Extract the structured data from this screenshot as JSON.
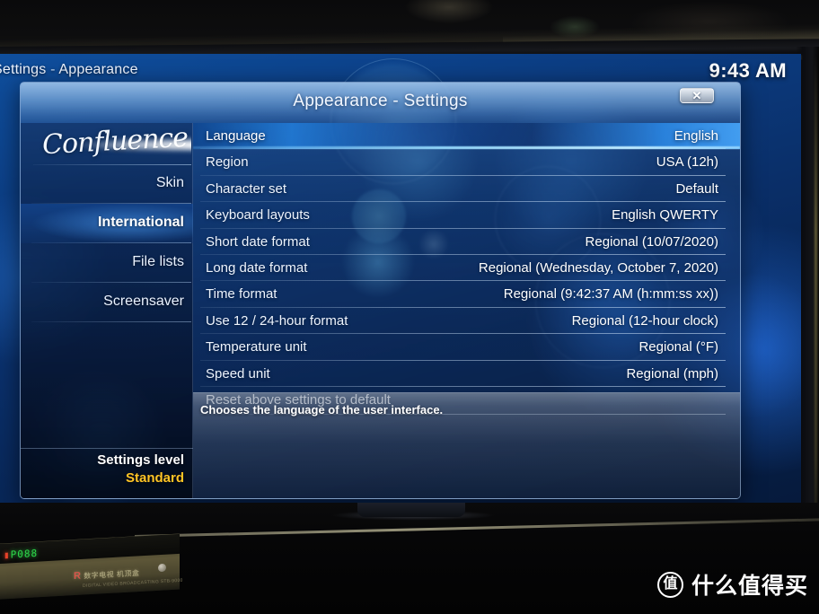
{
  "statusbar": {
    "breadcrumb_root": "Settings",
    "breadcrumb_sep": "-",
    "breadcrumb_current": "Appearance",
    "clock": "9:43 AM"
  },
  "dialog": {
    "title": "Appearance - Settings",
    "close_label": "✕",
    "logo_text": "Confluence"
  },
  "sidebar": {
    "items": [
      {
        "label": "Skin",
        "selected": false
      },
      {
        "label": "International",
        "selected": true
      },
      {
        "label": "File lists",
        "selected": false
      },
      {
        "label": "Screensaver",
        "selected": false
      }
    ],
    "settings_level_title": "Settings level",
    "settings_level_value": "Standard",
    "settings_level_color": "#ffc425"
  },
  "settings_rows": [
    {
      "name": "Language",
      "value": "English",
      "selected": true
    },
    {
      "name": "Region",
      "value": "USA (12h)",
      "selected": false
    },
    {
      "name": "Character set",
      "value": "Default",
      "selected": false
    },
    {
      "name": "Keyboard layouts",
      "value": "English QWERTY",
      "selected": false
    },
    {
      "name": "Short date format",
      "value": "Regional (10/07/2020)",
      "selected": false
    },
    {
      "name": "Long date format",
      "value": "Regional (Wednesday, October 7, 2020)",
      "selected": false
    },
    {
      "name": "Time format",
      "value": "Regional (9:42:37 AM (h:mm:ss xx))",
      "selected": false
    },
    {
      "name": "Use 12 / 24-hour format",
      "value": "Regional (12-hour clock)",
      "selected": false
    },
    {
      "name": "Temperature unit",
      "value": "Regional (°F)",
      "selected": false
    },
    {
      "name": "Speed unit",
      "value": "Regional (mph)",
      "selected": false
    },
    {
      "name": "Reset above settings to default",
      "value": "",
      "selected": false
    }
  ],
  "help": {
    "text": "Chooses the language of the user interface."
  },
  "navbuttons": {
    "back_label": "back-arrow",
    "home_label": "home"
  },
  "device": {
    "led_text": "P088",
    "led_prefix": "▮",
    "brand": "数字电视 机顶盒",
    "brand_sub": "DIGITAL VIDEO BROADCASTING  STB-9000"
  },
  "watermark": {
    "badge": "值",
    "text": "什么值得买"
  },
  "colors": {
    "accent_blue": "#2a82e1",
    "highlight_cyan": "#8fd4ff",
    "screen_deep": "#072350",
    "amber": "#ffc425",
    "panel_dark": "#0a1c3e"
  }
}
